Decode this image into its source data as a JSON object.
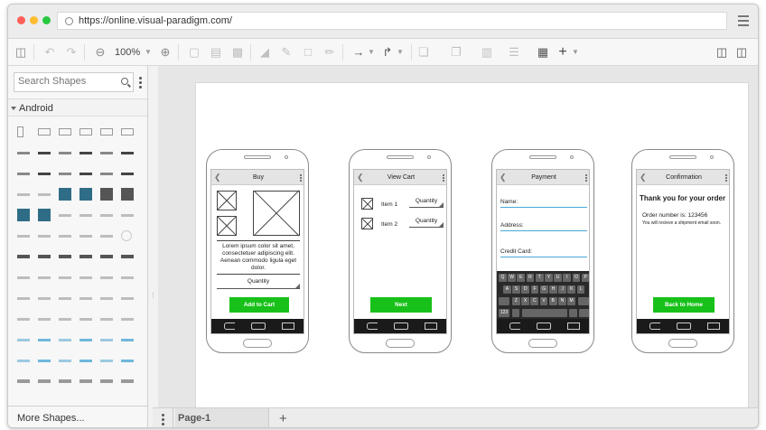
{
  "browser": {
    "url": "https://online.visual-paradigm.com/",
    "traffic_colors": [
      "#ff5f57",
      "#febc2e",
      "#28c840"
    ]
  },
  "toolbar": {
    "zoom": "100%",
    "icons": [
      "save-icon",
      "undo-icon",
      "redo-icon",
      "zoom-out-icon",
      "zoom-in-icon",
      "copy-icon",
      "paste-icon",
      "delete-icon",
      "fill-color-icon",
      "line-color-icon",
      "shadow-icon",
      "format-painter-icon",
      "connector-icon",
      "waypoint-icon",
      "to-front-icon",
      "to-back-icon",
      "align-icon",
      "distribute-icon",
      "select-icon",
      "add-icon",
      "outline-icon",
      "panel-icon"
    ]
  },
  "sidebar": {
    "search_placeholder": "Search Shapes",
    "category": "Android",
    "more_shapes": "More Shapes..."
  },
  "pages": {
    "current": "Page-1"
  },
  "phones": [
    {
      "title": "Buy",
      "text": "Lorem ipsum color sit amet, consectetuer adipiscing elit. Aenean commodo ligula eget dolor.",
      "dropdown": "Quantity",
      "button": "Add to Cart"
    },
    {
      "title": "View Cart",
      "items": [
        {
          "label": "Item 1",
          "dropdown": "Quantity"
        },
        {
          "label": "Item 2",
          "dropdown": "Quantity"
        }
      ],
      "button": "Next"
    },
    {
      "title": "Payment",
      "fields": [
        "Name:",
        "Address:",
        "Credit Card:"
      ],
      "keyboard": {
        "row1": [
          "Q",
          "W",
          "E",
          "R",
          "T",
          "Y",
          "U",
          "I",
          "O",
          "P"
        ],
        "row2": [
          "A",
          "S",
          "D",
          "F",
          "G",
          "H",
          "J",
          "K",
          "L"
        ],
        "row3": [
          "Z",
          "X",
          "C",
          "V",
          "B",
          "N",
          "M"
        ],
        "num": "123"
      }
    },
    {
      "title": "Confirmation",
      "heading": "Thank you for your order",
      "order": "Order number is: 123456",
      "note": "You will recieve a shipment email soon.",
      "button": "Back to Home"
    }
  ],
  "colors": {
    "accent_green": "#18c11a",
    "field_underline": "#4aa8d8",
    "teal_shapes": "#2f6d86"
  }
}
